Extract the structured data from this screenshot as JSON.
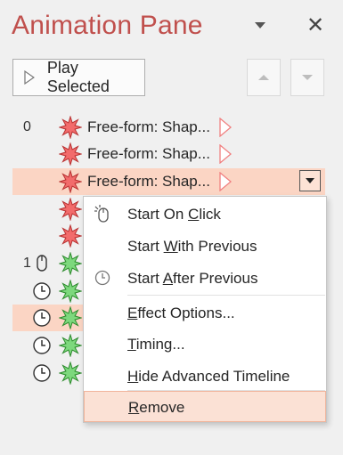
{
  "pane": {
    "title": "Animation Pane"
  },
  "toolbar": {
    "play_label": "Play Selected",
    "up_icon": "move-up-icon",
    "down_icon": "move-down-icon"
  },
  "rows": [
    {
      "num": "0",
      "name": "Free-form: Shap...",
      "effect": "emphasis",
      "trigger": "none",
      "selected": false
    },
    {
      "num": "",
      "name": "Free-form: Shap...",
      "effect": "emphasis",
      "trigger": "none",
      "selected": false
    },
    {
      "num": "",
      "name": "Free-form: Shap...",
      "effect": "emphasis",
      "trigger": "none",
      "selected": true
    },
    {
      "num": "",
      "name": "",
      "effect": "emphasis",
      "trigger": "none",
      "selected": false
    },
    {
      "num": "",
      "name": "",
      "effect": "emphasis",
      "trigger": "none",
      "selected": false
    },
    {
      "num": "1",
      "name": "",
      "effect": "entrance",
      "trigger": "on-click",
      "selected": false
    },
    {
      "num": "",
      "name": "",
      "effect": "entrance",
      "trigger": "after-previous",
      "selected": false
    },
    {
      "num": "",
      "name": "",
      "effect": "entrance",
      "trigger": "after-previous",
      "selected": false
    },
    {
      "num": "",
      "name": "",
      "effect": "entrance",
      "trigger": "after-previous",
      "selected": false
    },
    {
      "num": "",
      "name": "",
      "effect": "entrance",
      "trigger": "after-previous",
      "selected": false
    }
  ],
  "context_menu": {
    "start_on_click": {
      "pre": "Start On ",
      "key": "C",
      "post": "lick"
    },
    "start_with_previous": {
      "pre": "Start ",
      "key": "W",
      "post": "ith Previous"
    },
    "start_after_previous": {
      "pre": "Start ",
      "key": "A",
      "post": "fter Previous"
    },
    "effect_options": {
      "pre": "",
      "key": "E",
      "post": "ffect Options..."
    },
    "timing": {
      "pre": "",
      "key": "T",
      "post": "iming..."
    },
    "hide_timeline": {
      "pre": "",
      "key": "H",
      "post": "ide Advanced Timeline"
    },
    "remove": {
      "pre": "",
      "key": "R",
      "post": "emove"
    }
  },
  "colors": {
    "title": "#c0504d",
    "selection": "#fbd5c4",
    "emphasis_star": "#f26b6b",
    "entrance_star": "#7dd87d",
    "timing_bar": "#f08080"
  }
}
